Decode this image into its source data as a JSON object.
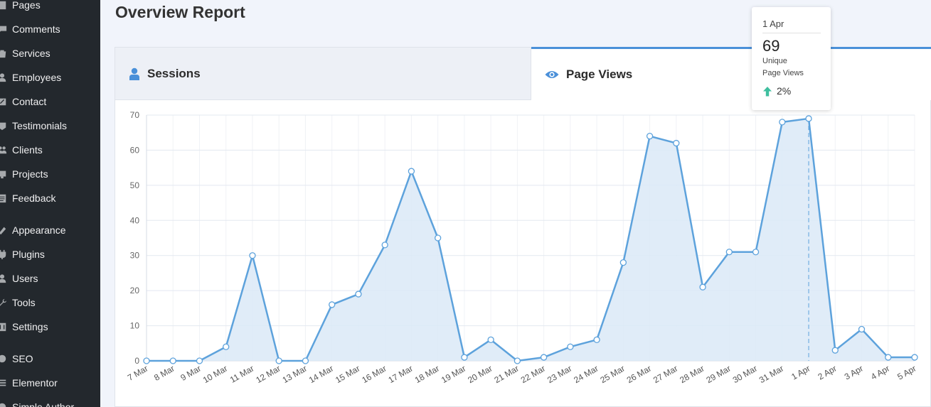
{
  "sidebar": {
    "items": [
      {
        "label": "Pages",
        "icon": "pages-icon",
        "top": -5
      },
      {
        "label": "Comments",
        "icon": "comments-icon",
        "top": 29
      },
      {
        "label": "Services",
        "icon": "services-icon",
        "top": 63
      },
      {
        "label": "Employees",
        "icon": "employees-icon",
        "top": 97
      },
      {
        "label": "Contact",
        "icon": "contact-icon",
        "top": 131
      },
      {
        "label": "Testimonials",
        "icon": "testimonials-icon",
        "top": 165
      },
      {
        "label": "Clients",
        "icon": "clients-icon",
        "top": 199
      },
      {
        "label": "Projects",
        "icon": "projects-icon",
        "top": 233
      },
      {
        "label": "Feedback",
        "icon": "feedback-icon",
        "top": 267
      },
      {
        "label": "Appearance",
        "icon": "appearance-icon",
        "top": 312
      },
      {
        "label": "Plugins",
        "icon": "plugins-icon",
        "top": 346
      },
      {
        "label": "Users",
        "icon": "users-icon",
        "top": 380
      },
      {
        "label": "Tools",
        "icon": "tools-icon",
        "top": 414
      },
      {
        "label": "Settings",
        "icon": "settings-icon",
        "top": 448
      },
      {
        "label": "SEO",
        "icon": "seo-icon",
        "top": 493
      },
      {
        "label": "Elementor",
        "icon": "elementor-icon",
        "top": 527
      },
      {
        "label": "Simple Author",
        "icon": "simple-author-icon",
        "top": 561
      }
    ]
  },
  "header": {
    "title": "Overview Report"
  },
  "tabs": {
    "sessions": {
      "label": "Sessions",
      "icon": "user-icon"
    },
    "page_views": {
      "label": "Page Views",
      "icon": "eye-icon"
    }
  },
  "colors": {
    "line": "#5da2dc",
    "area": "#dbe9f7",
    "accent": "#4a90d9",
    "up": "#3fbf9f"
  },
  "tooltip": {
    "date": "1 Apr",
    "value": "69",
    "label_line1": "Unique",
    "label_line2": "Page Views",
    "change": "2%",
    "change_icon": "arrow-up-icon"
  },
  "chart_data": {
    "type": "area",
    "categories": [
      "7 Mar",
      "8 Mar",
      "9 Mar",
      "10 Mar",
      "11 Mar",
      "12 Mar",
      "13 Mar",
      "14 Mar",
      "15 Mar",
      "16 Mar",
      "17 Mar",
      "18 Mar",
      "19 Mar",
      "20 Mar",
      "21 Mar",
      "22 Mar",
      "23 Mar",
      "24 Mar",
      "25 Mar",
      "26 Mar",
      "27 Mar",
      "28 Mar",
      "29 Mar",
      "30 Mar",
      "31 Mar",
      "1 Apr",
      "2 Apr",
      "3 Apr",
      "4 Apr",
      "5 Apr"
    ],
    "values": [
      0,
      0,
      0,
      4,
      30,
      0,
      0,
      16,
      19,
      33,
      54,
      35,
      1,
      6,
      0,
      1,
      4,
      6,
      28,
      64,
      62,
      21,
      31,
      31,
      68,
      69,
      3,
      9,
      1,
      1
    ],
    "yticks": [
      0,
      10,
      20,
      30,
      40,
      50,
      60,
      70
    ],
    "ylim": [
      0,
      70
    ],
    "grid": true,
    "highlight_category": "1 Apr"
  }
}
